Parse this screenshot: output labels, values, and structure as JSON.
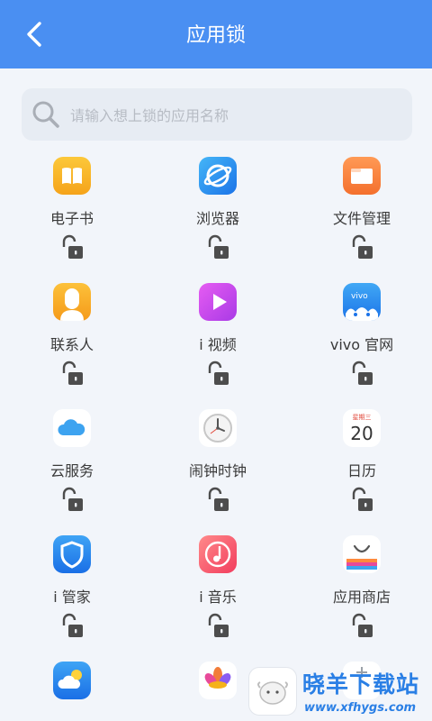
{
  "header": {
    "title": "应用锁",
    "back_icon": "chevron-left-icon",
    "background": "#4a8ff2"
  },
  "search": {
    "placeholder": "请输入想上锁的应用名称",
    "icon": "search-icon"
  },
  "apps": [
    {
      "label": "电子书",
      "icon": "book-icon",
      "locked": false
    },
    {
      "label": "浏览器",
      "icon": "browser-icon",
      "locked": false
    },
    {
      "label": "文件管理",
      "icon": "folder-icon",
      "locked": false
    },
    {
      "label": "联系人",
      "icon": "contacts-icon",
      "locked": false
    },
    {
      "label": "i 视频",
      "icon": "video-icon",
      "locked": false
    },
    {
      "label": "vivo 官网",
      "icon": "vivo-store-icon",
      "locked": false
    },
    {
      "label": "云服务",
      "icon": "cloud-icon",
      "locked": false
    },
    {
      "label": "闹钟时钟",
      "icon": "clock-icon",
      "locked": false
    },
    {
      "label": "日历",
      "icon": "calendar-icon",
      "locked": false
    },
    {
      "label": "i 管家",
      "icon": "shield-icon",
      "locked": false
    },
    {
      "label": "i 音乐",
      "icon": "music-icon",
      "locked": false
    },
    {
      "label": "应用商店",
      "icon": "app-store-icon",
      "locked": false
    }
  ],
  "calendar_icon": {
    "weekday": "星期三",
    "day": "20"
  },
  "lock_icon": "unlocked-padlock-icon",
  "watermark": {
    "name": "晓羊下载站",
    "url": "www.xfhygs.com"
  }
}
